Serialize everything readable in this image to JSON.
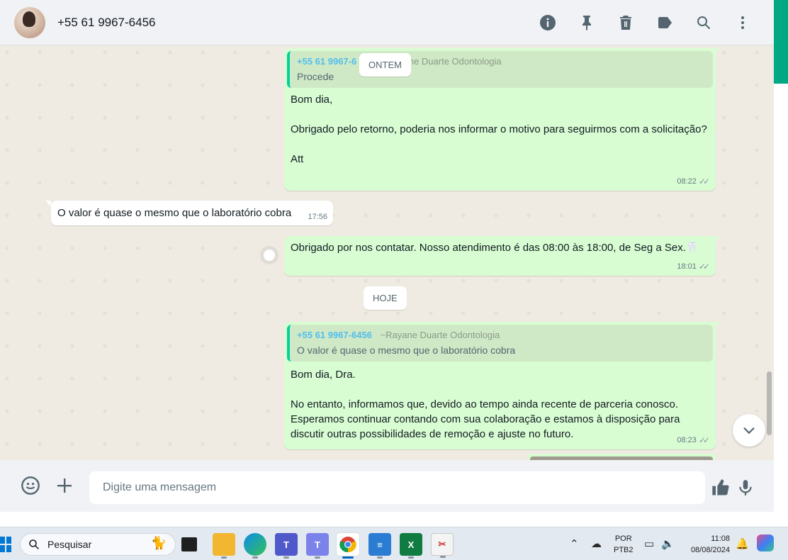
{
  "header": {
    "contact_name": "+55 61 9967-6456",
    "icons": [
      "info-icon",
      "pin-icon",
      "delete-icon",
      "label-icon",
      "search-icon",
      "menu-icon"
    ]
  },
  "colors": {
    "accent": "#00a884",
    "outgoing": "#d9fdd3",
    "incoming": "#ffffff",
    "quote_name": "#53bdeb"
  },
  "chat": {
    "date_yesterday": "ONTEM",
    "date_today": "HOJE",
    "messages": [
      {
        "direction": "out",
        "quote_phone": "+55 61 9967-6",
        "quote_alias": "ne Duarte Odontologia",
        "quote_text": "Procede",
        "text": "Bom dia,\n\nObrigado pelo retorno, poderia nos informar o motivo para seguirmos com a solicitação?\n\nAtt",
        "time": "08:22"
      },
      {
        "direction": "in",
        "text": "O valor é quase o mesmo que o laboratório cobra",
        "time": "17:56"
      },
      {
        "direction": "out",
        "text": "Obrigado por nos contatar. Nosso atendimento é das 08:00 às 18:00, de Seg a Sex.🦷",
        "time": "18:01"
      },
      {
        "direction": "out",
        "quote_phone": "+55 61 9967-6456",
        "quote_alias": "~Rayane Duarte Odontologia",
        "quote_text": "O valor é quase o mesmo que o laboratório cobra",
        "text": "Bom dia, Dra.\n\nNo entanto, informamos que, devido ao tempo ainda recente de parceria conosco. Esperamos continuar contando com sua colaboração e estamos à disposição para discutir outras possibilidades de remoção e ajuste no futuro.",
        "time": "08:23"
      }
    ]
  },
  "composer": {
    "placeholder": "Digite uma mensagem"
  },
  "taskbar": {
    "search_label": "Pesquisar",
    "lang_top": "POR",
    "lang_bottom": "PTB2",
    "time": "11:08",
    "date": "08/08/2024"
  }
}
